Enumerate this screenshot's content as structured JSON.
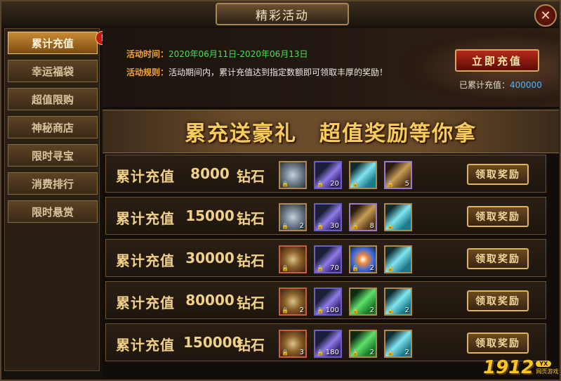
{
  "window": {
    "title": "精彩活动",
    "close_label": "✕"
  },
  "sidebar": {
    "items": [
      {
        "label": "累计充值",
        "active": true,
        "alert": "!"
      },
      {
        "label": "幸运福袋",
        "active": false
      },
      {
        "label": "超值限购",
        "active": false
      },
      {
        "label": "神秘商店",
        "active": false
      },
      {
        "label": "限时寻宝",
        "active": false
      },
      {
        "label": "消费排行",
        "active": false
      },
      {
        "label": "限时悬赏",
        "active": false
      }
    ]
  },
  "activity": {
    "time_label": "活动时间：",
    "time_value": "2020年06月11日-2020年06月13日",
    "rule_label": "活动规则：",
    "rule_value": "活动期间内，累计充值达到指定数额即可领取丰厚的奖励！",
    "recharge_button": "立即充值",
    "total_label": "已累计充值：",
    "total_value": "400000"
  },
  "banner": {
    "text": "累充送豪礼　超值奖励等你拿"
  },
  "tiers": [
    {
      "label": "累计充值",
      "amount": "8000",
      "unit": "钻石",
      "claim": "领取奖励",
      "items": [
        {
          "icon": "gear-coin-icon",
          "qty": ""
        },
        {
          "icon": "feather-icon",
          "qty": "20"
        },
        {
          "icon": "crystal-icon",
          "qty": ""
        },
        {
          "icon": "scroll-bag-icon",
          "qty": "5"
        }
      ]
    },
    {
      "label": "累计充值",
      "amount": "15000",
      "unit": "钻石",
      "claim": "领取奖励",
      "items": [
        {
          "icon": "gear-coin-icon",
          "qty": "2"
        },
        {
          "icon": "feather-icon",
          "qty": "30"
        },
        {
          "icon": "scroll-bag-icon",
          "qty": "8"
        },
        {
          "icon": "crystal-icon",
          "qty": ""
        }
      ]
    },
    {
      "label": "累计充值",
      "amount": "30000",
      "unit": "钻石",
      "claim": "领取奖励",
      "items": [
        {
          "icon": "compass-icon",
          "qty": ""
        },
        {
          "icon": "feather-icon",
          "qty": "70"
        },
        {
          "icon": "orb-icon",
          "qty": "2"
        },
        {
          "icon": "crystal-icon",
          "qty": ""
        }
      ]
    },
    {
      "label": "累计充值",
      "amount": "80000",
      "unit": "钻石",
      "claim": "领取奖励",
      "items": [
        {
          "icon": "compass-icon",
          "qty": "2"
        },
        {
          "icon": "feather-icon",
          "qty": "100"
        },
        {
          "icon": "emerald-icon",
          "qty": "2"
        },
        {
          "icon": "crystal-icon",
          "qty": "2"
        }
      ]
    },
    {
      "label": "累计充值",
      "amount": "150000",
      "unit": "钻石",
      "claim": "领取奖励",
      "items": [
        {
          "icon": "compass-icon",
          "qty": "3"
        },
        {
          "icon": "feather-icon",
          "qty": "180"
        },
        {
          "icon": "emerald-icon",
          "qty": "2"
        },
        {
          "icon": "crystal-icon",
          "qty": "2"
        }
      ]
    }
  ],
  "watermark": {
    "number": "1912",
    "tag": "YX",
    "sub": "网页游戏"
  },
  "colors": {
    "accent_gold": "#f1d08a",
    "time_green": "#4fdd54",
    "total_blue": "#4bb6ff",
    "label_orange": "#f2a637"
  }
}
